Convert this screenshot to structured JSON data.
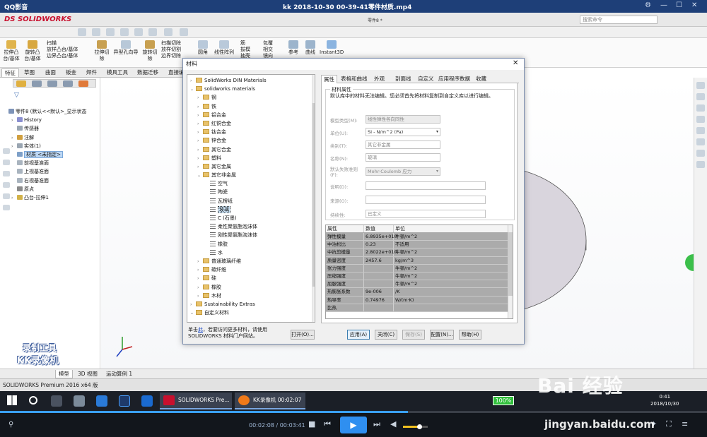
{
  "player_title": {
    "brand": "QQ影音",
    "filename": "kk 2018-10-30 00-39-41零件材质.mp4",
    "controls": [
      "⚙",
      "—",
      "☐",
      "✕"
    ]
  },
  "sw": {
    "logo": "DS SOLIDWORKS",
    "part_title": "零件8 *",
    "search_placeholder": "搜索命令",
    "ribbon": [
      "拉伸凸台/基体",
      "旋转凸台/基体",
      "扫描",
      "放样凸台/基体",
      "边界凸台/基体",
      "拉伸切除",
      "异型孔向导",
      "旋转切除",
      "扫描切除",
      "放样切割",
      "边界切除",
      "圆角",
      "线性阵列",
      "筋",
      "拔模",
      "抽壳",
      "包覆",
      "相交",
      "镜向",
      "参考",
      "曲线",
      "Instant3D"
    ],
    "command_tabs": [
      "特征",
      "草图",
      "曲面",
      "钣金",
      "焊件",
      "模具工具",
      "数据迁移",
      "直接编辑"
    ],
    "feature_tree": [
      {
        "label": "零件8 (默认<<默认>_显示状态",
        "expand": "",
        "color": "#7d93b8"
      },
      {
        "label": "History",
        "expand": "›",
        "color": "#8a8fd0"
      },
      {
        "label": "传感器",
        "expand": "",
        "color": "#9aa6b2"
      },
      {
        "label": "注解",
        "expand": "›",
        "color": "#d0a040"
      },
      {
        "label": "实体(1)",
        "expand": "›",
        "color": "#9aa6b2"
      },
      {
        "label": "材质 <未指定>",
        "expand": "",
        "color": "#7ea0c8",
        "selected": true
      },
      {
        "label": "前视基准面",
        "expand": "",
        "color": "#a9b4bf"
      },
      {
        "label": "上视基准面",
        "expand": "",
        "color": "#a9b4bf"
      },
      {
        "label": "右视基准面",
        "expand": "",
        "color": "#a9b4bf"
      },
      {
        "label": "原点",
        "expand": "",
        "color": "#8a8a8a"
      },
      {
        "label": "凸台-拉伸1",
        "expand": "›",
        "color": "#d2b24a"
      }
    ],
    "bottom_tabs": [
      "模型",
      "3D 视图",
      "运动算例 1"
    ],
    "status": "SOLIDWORKS Premium 2016 x64 版",
    "watermark": [
      "录制工具",
      "KK录像机"
    ]
  },
  "dialog": {
    "title": "材料",
    "tree": [
      {
        "label": "SolidWorks DIN Materials",
        "expand": "›",
        "kind": "folder",
        "indent": 0
      },
      {
        "label": "solidworks materials",
        "expand": "⌄",
        "kind": "folder",
        "indent": 0
      },
      {
        "label": "钢",
        "expand": "›",
        "kind": "folder",
        "indent": 1
      },
      {
        "label": "铁",
        "expand": "›",
        "kind": "folder",
        "indent": 1
      },
      {
        "label": "铝合金",
        "expand": "›",
        "kind": "folder",
        "indent": 1
      },
      {
        "label": "红铜合金",
        "expand": "›",
        "kind": "folder",
        "indent": 1
      },
      {
        "label": "钛合金",
        "expand": "›",
        "kind": "folder",
        "indent": 1
      },
      {
        "label": "锌合金",
        "expand": "›",
        "kind": "folder",
        "indent": 1
      },
      {
        "label": "其它合金",
        "expand": "›",
        "kind": "folder",
        "indent": 1
      },
      {
        "label": "塑料",
        "expand": "›",
        "kind": "folder",
        "indent": 1
      },
      {
        "label": "其它金属",
        "expand": "›",
        "kind": "folder",
        "indent": 1
      },
      {
        "label": "其它非金属",
        "expand": "⌄",
        "kind": "folder",
        "indent": 1
      },
      {
        "label": "空气",
        "expand": "",
        "kind": "material",
        "indent": 2
      },
      {
        "label": "陶瓷",
        "expand": "",
        "kind": "material",
        "indent": 2
      },
      {
        "label": "瓦楞纸",
        "expand": "",
        "kind": "material",
        "indent": 2
      },
      {
        "label": "玻璃",
        "expand": "",
        "kind": "material",
        "indent": 2,
        "selected": true
      },
      {
        "label": "C (石墨)",
        "expand": "",
        "kind": "material",
        "indent": 2
      },
      {
        "label": "柔性聚氨酯泡沫体",
        "expand": "",
        "kind": "material",
        "indent": 2
      },
      {
        "label": "刚性聚氨酯泡沫体",
        "expand": "",
        "kind": "material",
        "indent": 2
      },
      {
        "label": "橡胶",
        "expand": "",
        "kind": "material",
        "indent": 2
      },
      {
        "label": "水",
        "expand": "",
        "kind": "material",
        "indent": 2
      },
      {
        "label": "普通玻璃纤维",
        "expand": "›",
        "kind": "folder",
        "indent": 1
      },
      {
        "label": "碳纤维",
        "expand": "›",
        "kind": "folder",
        "indent": 1
      },
      {
        "label": "硅",
        "expand": "›",
        "kind": "folder",
        "indent": 1
      },
      {
        "label": "橡胶",
        "expand": "›",
        "kind": "folder",
        "indent": 1
      },
      {
        "label": "木材",
        "expand": "›",
        "kind": "folder",
        "indent": 1
      },
      {
        "label": "Sustainability Extras",
        "expand": "›",
        "kind": "folder",
        "indent": 0
      },
      {
        "label": "自定义材料",
        "expand": "⌄",
        "kind": "folder",
        "indent": 0
      }
    ],
    "note_prefix": "单击",
    "note_link": "此",
    "note_rest": "，若要访问更多材料，请使用 SOLIDWORKS 材料门户网站。",
    "open_button": "打开(O)...",
    "tabs": [
      "属性",
      "表格和曲线",
      "外观",
      "剖面线",
      "自定义",
      "应用程序数据",
      "收藏"
    ],
    "group_title": "材料属性",
    "group_note": "默认库中的材料无法编辑。您必须首先将材料复制到自定义库以进行编辑。",
    "fields": [
      {
        "label": "模型类型(M):",
        "value": "线性弹性各向同性",
        "wide": false
      },
      {
        "label": "单位(U):",
        "value": "SI - N/m^2 (Pa)",
        "wide": false,
        "dropdown": true
      },
      {
        "label": "类别(T):",
        "value": "其它非金属",
        "wide": false
      },
      {
        "label": "名称(N):",
        "value": "玻璃",
        "wide": false
      },
      {
        "label": "默认失败准则(F):",
        "value": "Mohr-Coulomb 应力",
        "wide": false,
        "dropdown": true
      },
      {
        "label": "说明(D):",
        "value": "",
        "wide": true
      },
      {
        "label": "来源(O):",
        "value": "",
        "wide": true
      },
      {
        "label": "持续性:",
        "value": "已定义",
        "wide": true
      }
    ],
    "table_headers": [
      "属性",
      "数值",
      "单位"
    ],
    "table_rows": [
      [
        "弹性模量",
        "6.8935e+010",
        "牛顿/m^2"
      ],
      [
        "中泊松比",
        "0.23",
        "不适用"
      ],
      [
        "中抗剪模量",
        "2.8022e+010",
        "牛顿/m^2"
      ],
      [
        "质量密度",
        "2457.6",
        "kg/m^3"
      ],
      [
        "张力强度",
        "",
        "牛顿/m^2"
      ],
      [
        "压缩强度",
        "",
        "牛顿/m^2"
      ],
      [
        "屈服强度",
        "",
        "牛顿/m^2"
      ],
      [
        "热膨胀系数",
        "9e-006",
        "/K"
      ],
      [
        "热导率",
        "0.74976",
        "W/(m·K)"
      ],
      [
        "比热",
        "",
        ""
      ]
    ],
    "buttons": {
      "apply": "应用(A)",
      "close": "关闭(C)",
      "save": "保存(S)",
      "config": "配置(N)...",
      "help": "帮助(H)"
    }
  },
  "taskbar": {
    "apps": [
      {
        "label": "SOLIDWORKS Pre...",
        "color": "#c8102e"
      },
      {
        "label": "KK录像机 00:02:07",
        "color": "#f07a1a"
      }
    ],
    "battery": "100%",
    "time": "0:41",
    "date": "2018/10/30"
  },
  "playback": {
    "current": "00:02:08",
    "total": "00:03:41",
    "progress": 0.577,
    "volume": 0.6
  },
  "baidu": {
    "logo": "Bai 经验",
    "url": "jingyan.baidu.com"
  }
}
